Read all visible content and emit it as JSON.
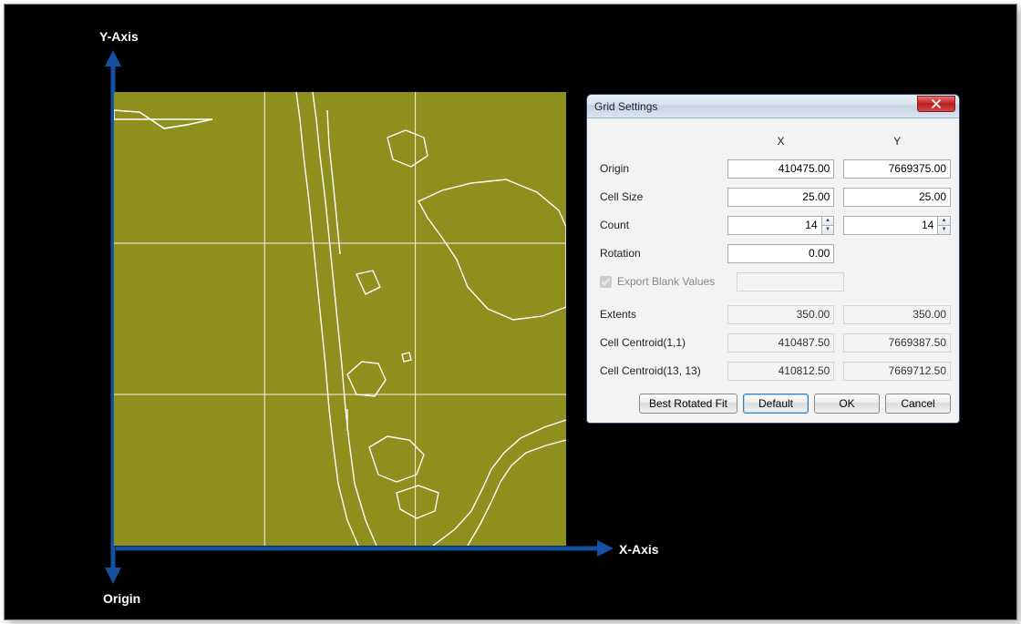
{
  "axes": {
    "y_label": "Y-Axis",
    "x_label": "X-Axis",
    "origin_label": "Origin"
  },
  "dialog": {
    "title": "Grid Settings",
    "headers": {
      "x": "X",
      "y": "Y"
    },
    "rows": {
      "origin": {
        "label": "Origin",
        "x": "410475.00",
        "y": "7669375.00"
      },
      "cell_size": {
        "label": "Cell Size",
        "x": "25.00",
        "y": "25.00"
      },
      "count": {
        "label": "Count",
        "x": "14",
        "y": "14"
      },
      "rotation": {
        "label": "Rotation",
        "x": "0.00"
      },
      "export_blank": {
        "label": "Export Blank Values",
        "checked": true
      },
      "extents": {
        "label": "Extents",
        "x": "350.00",
        "y": "350.00"
      },
      "centroid1": {
        "label": "Cell Centroid(1,1)",
        "x": "410487.50",
        "y": "7669387.50"
      },
      "centroid13": {
        "label": "Cell Centroid(13, 13)",
        "x": "410812.50",
        "y": "7669712.50"
      }
    },
    "buttons": {
      "best_fit": "Best Rotated Fit",
      "default": "Default",
      "ok": "OK",
      "cancel": "Cancel"
    }
  }
}
